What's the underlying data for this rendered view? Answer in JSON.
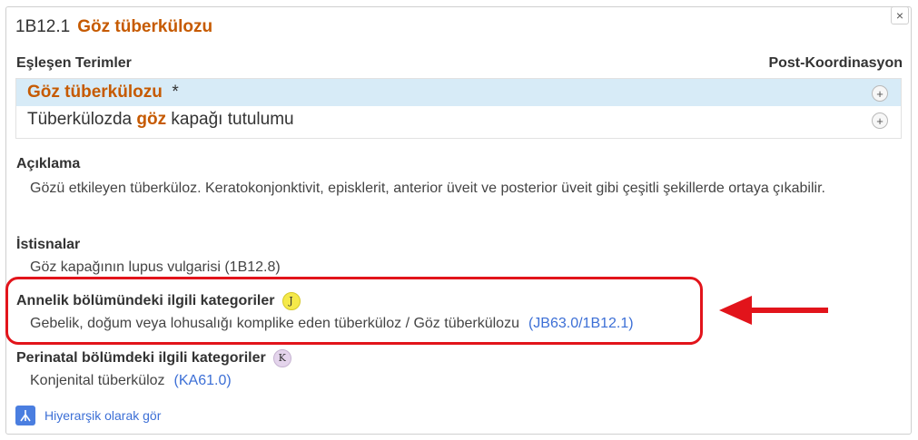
{
  "header": {
    "code": "1B12.1",
    "title": "Göz tüberkülozu"
  },
  "close": {
    "glyph": "×"
  },
  "matching_terms": {
    "label": "Eşleşen Terimler",
    "post_coordination_label": "Post-Koordinasyon",
    "rows": [
      {
        "highlight": "Göz tüberkülozu",
        "before": "",
        "after": "  *",
        "plus": "+"
      },
      {
        "before": "Tüberkülozda ",
        "highlight": "göz",
        "after": " kapağı tutulumu",
        "plus": "+"
      }
    ]
  },
  "description": {
    "title": "Açıklama",
    "text": "Gözü etkileyen tüberküloz. Keratokonjonktivit, episklerit, anterior üveit ve posterior üveit gibi çeşitli şekillerde ortaya çıkabilir."
  },
  "exclusions": {
    "title": "İstisnalar",
    "text": "Göz kapağının lupus vulgarisi (1B12.8)"
  },
  "maternal": {
    "title": "Annelik bölümündeki ilgili kategoriler",
    "badge": "J",
    "text": "Gebelik, doğum veya lohusalığı komplike eden tüberküloz / Göz tüberkülozu",
    "link": "(JB63.0/1B12.1)"
  },
  "perinatal": {
    "title": "Perinatal bölümdeki ilgili kategoriler",
    "badge": "K",
    "text": "Konjenital tüberküloz",
    "link": "(KA61.0)"
  },
  "hierarchy_link": {
    "label": "Hiyerarşik olarak gör"
  },
  "colors": {
    "accent": "#c65a00",
    "link": "#3c6fd6",
    "annotation": "#e2141b",
    "selected_row": "#d7ebf7"
  }
}
